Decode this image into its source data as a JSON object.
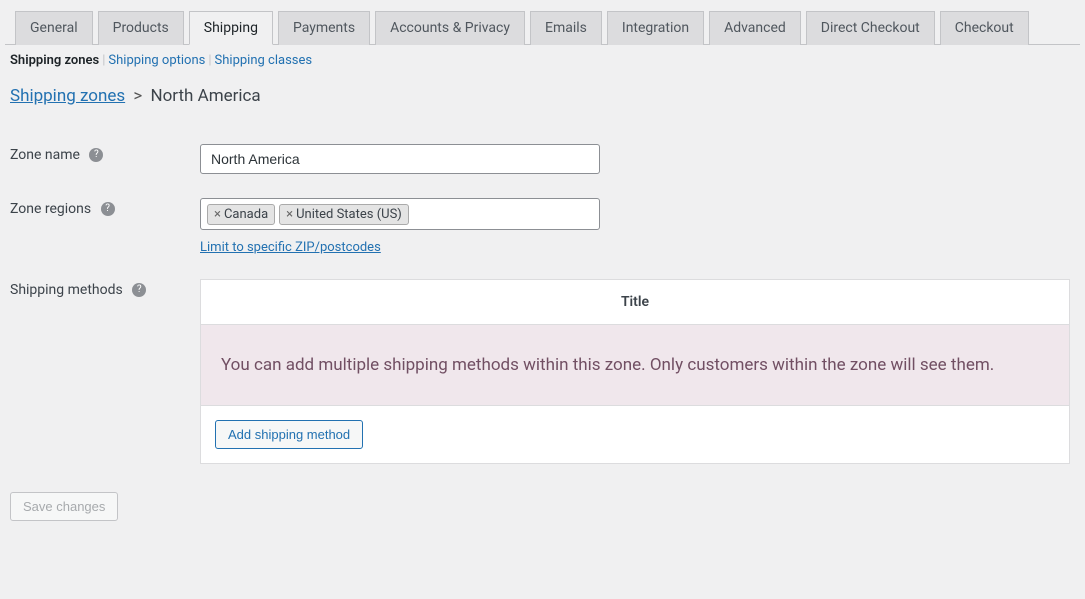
{
  "tabs": [
    "General",
    "Products",
    "Shipping",
    "Payments",
    "Accounts & Privacy",
    "Emails",
    "Integration",
    "Advanced",
    "Direct Checkout",
    "Checkout"
  ],
  "active_tab": "Shipping",
  "subnav": {
    "items": [
      "Shipping zones",
      "Shipping options",
      "Shipping classes"
    ],
    "current": "Shipping zones"
  },
  "breadcrumb": {
    "root": "Shipping zones",
    "current": "North America"
  },
  "form": {
    "zone_name": {
      "label": "Zone name",
      "value": "North America"
    },
    "zone_regions": {
      "label": "Zone regions",
      "tags": [
        "Canada",
        "United States (US)"
      ],
      "limit_link": "Limit to specific ZIP/postcodes"
    },
    "shipping_methods": {
      "label": "Shipping methods",
      "title_header": "Title",
      "empty_msg": "You can add multiple shipping methods within this zone. Only customers within the zone will see them.",
      "add_button": "Add shipping method"
    }
  },
  "save_button": "Save changes"
}
